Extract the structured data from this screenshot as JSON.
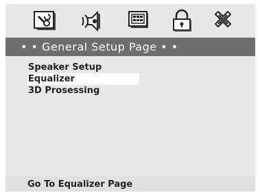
{
  "icons": [
    {
      "name": "general-setup-icon"
    },
    {
      "name": "speaker-setup-icon"
    },
    {
      "name": "video-setup-icon"
    },
    {
      "name": "password-lock-icon"
    },
    {
      "name": "exit-icon"
    }
  ],
  "title": "• • General Setup Page • •",
  "menu": {
    "items": [
      {
        "label": "Speaker Setup"
      },
      {
        "label": "Equalizer",
        "selected": true
      },
      {
        "label": "3D Prosessing"
      }
    ]
  },
  "status": "Go To Equalizer Page",
  "colors": {
    "background": "#e8e8e8",
    "title_bar": "#6e6e6e",
    "title_text": "#ffffff",
    "selection": "#ffffff",
    "text": "#222222"
  }
}
